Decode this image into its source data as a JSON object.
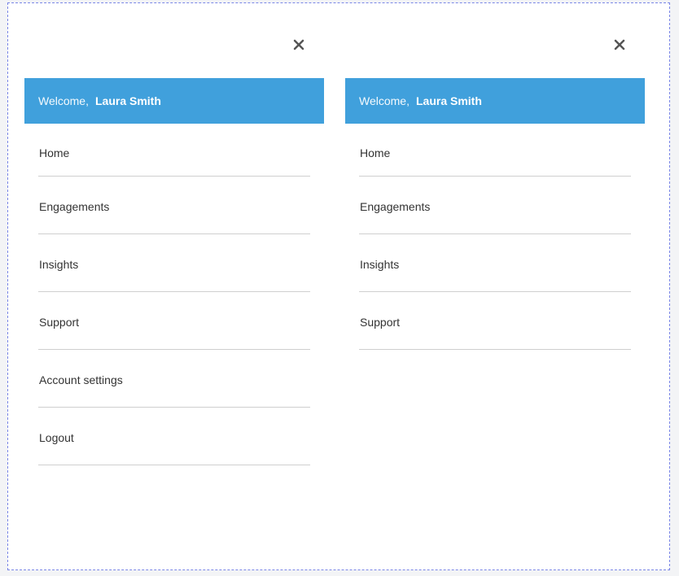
{
  "colors": {
    "header_bg": "#40a0dc",
    "header_text": "#ffffff",
    "menu_text": "#333333",
    "divider": "#cfcfcf",
    "frame_border": "#7a86e6"
  },
  "icons": {
    "close": "close-icon"
  },
  "panels": [
    {
      "welcome_label": "Welcome,",
      "user_name": "Laura Smith",
      "menu": [
        {
          "label": "Home"
        },
        {
          "label": "Engagements"
        },
        {
          "label": "Insights"
        },
        {
          "label": "Support"
        },
        {
          "label": "Account settings"
        },
        {
          "label": "Logout"
        }
      ]
    },
    {
      "welcome_label": "Welcome,",
      "user_name": "Laura Smith",
      "menu": [
        {
          "label": "Home"
        },
        {
          "label": "Engagements"
        },
        {
          "label": "Insights"
        },
        {
          "label": "Support"
        }
      ]
    }
  ]
}
